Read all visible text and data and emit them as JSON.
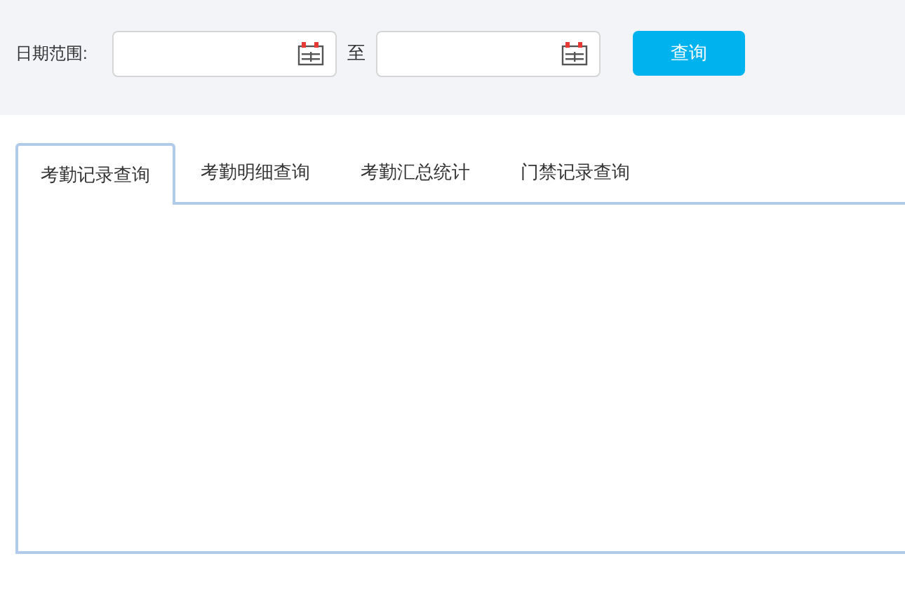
{
  "filter": {
    "label": "日期范围:",
    "separator": "至",
    "button": "查询"
  },
  "tabs": [
    {
      "label": "考勤记录查询",
      "selected": true
    },
    {
      "label": "考勤明细查询",
      "selected": false
    },
    {
      "label": "考勤汇总统计",
      "selected": false
    },
    {
      "label": "门禁记录查询",
      "selected": false
    }
  ]
}
